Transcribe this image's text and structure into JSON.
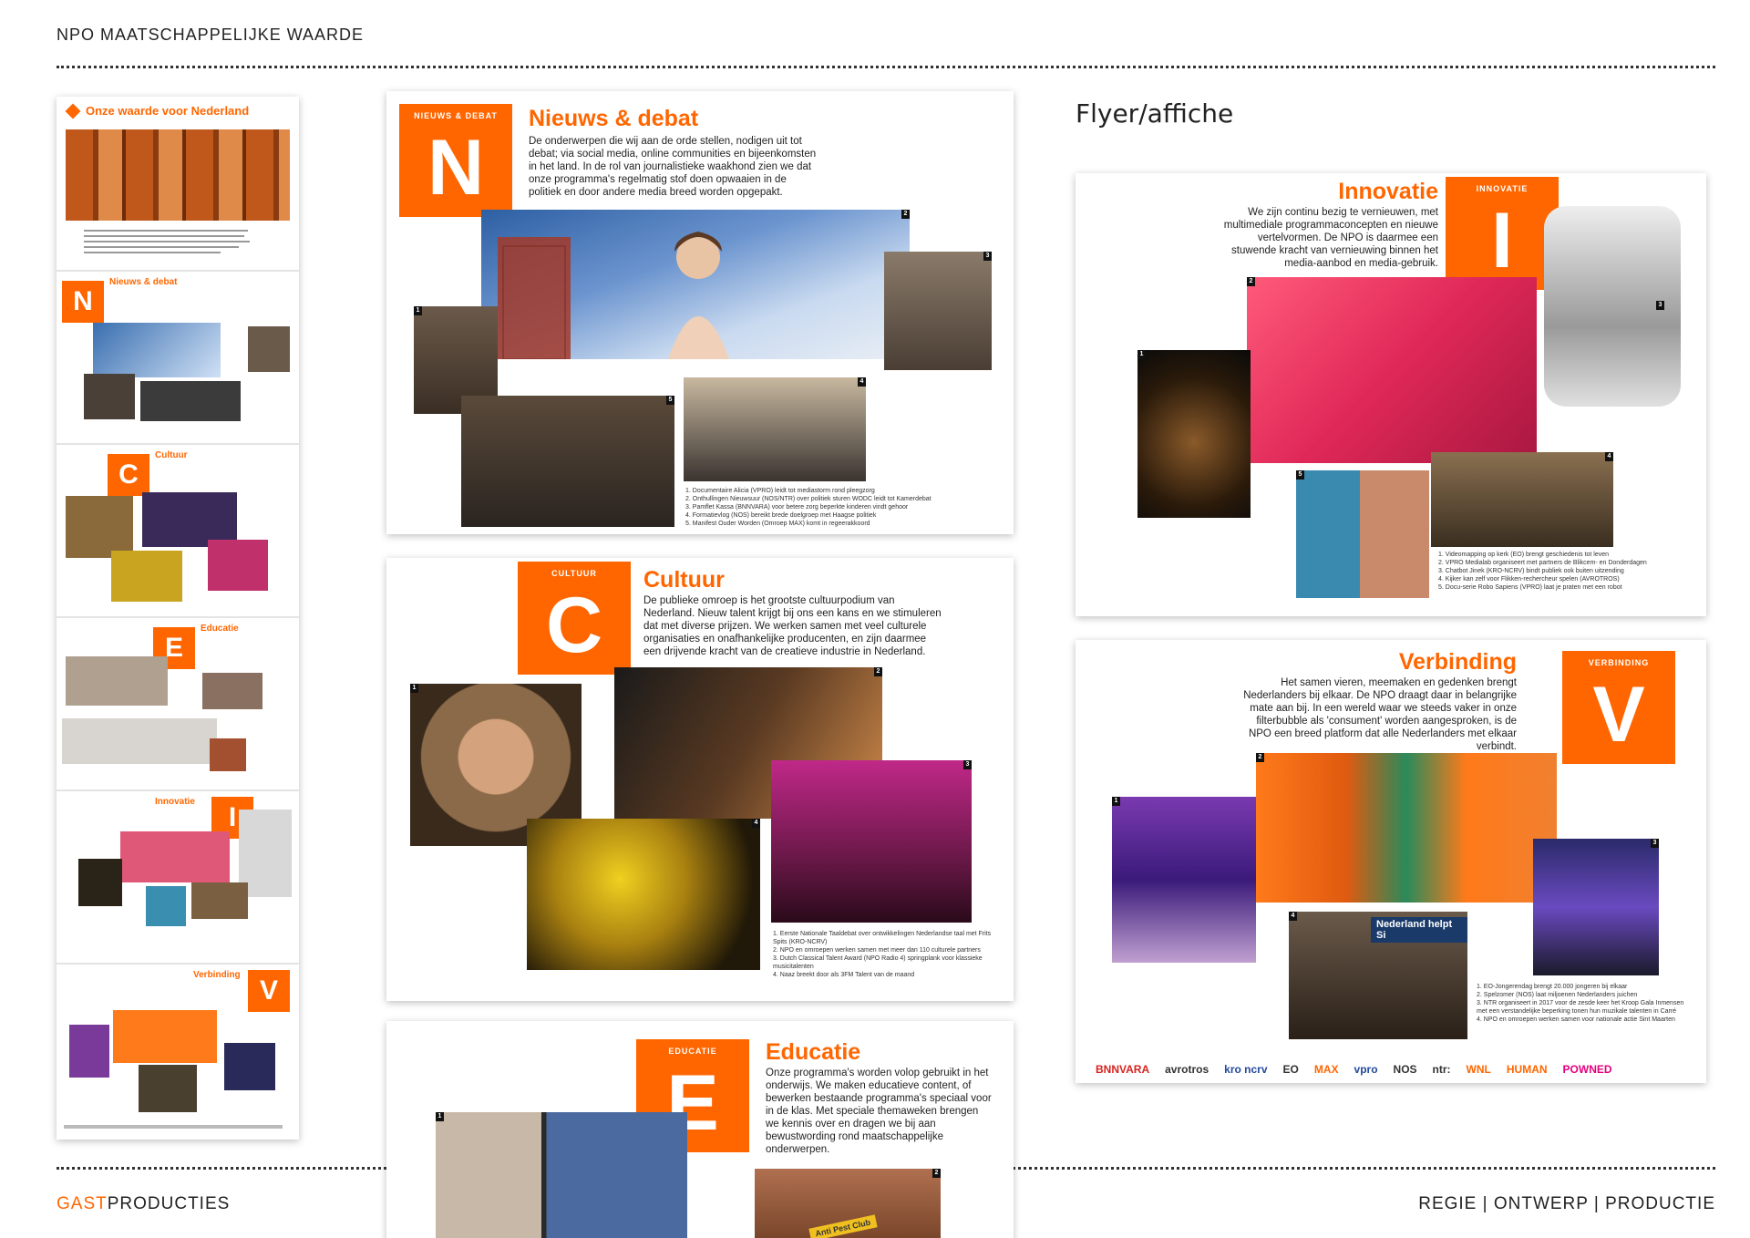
{
  "header": {
    "title": "NPO MAATSCHAPPELIJKE WAARDE"
  },
  "footer": {
    "brand_accent": "GAST",
    "brand_rest": "PRODUCTIES",
    "tagline": "REGIE | ONTWERP | PRODUCTIE"
  },
  "flyer_label": "Flyer/affiche",
  "thumbnail": {
    "title": "Onze waarde voor Nederland",
    "sections": [
      {
        "letter": "N",
        "label": "Nieuws & debat"
      },
      {
        "letter": "C",
        "label": "Cultuur"
      },
      {
        "letter": "E",
        "label": "Educatie"
      },
      {
        "letter": "I",
        "label": "Innovatie"
      },
      {
        "letter": "V",
        "label": "Verbinding"
      }
    ]
  },
  "nieuws": {
    "tag": "NIEUWS & DEBAT",
    "letter": "N",
    "title": "Nieuws & debat",
    "body": "De onderwerpen die wij aan de orde stellen, nodigen uit tot debat; via social media, online communities en bijeenkomsten in het land. In de rol van journalistieke waakhond zien we dat onze programma's regelmatig stof doen opwaaien in de politiek en door andere media breed worden opgepakt.",
    "captions": [
      "1. Documentaire Alicia (VPRO) leidt tot mediastorm rond pleegzorg",
      "2. Onthullingen Nieuwsuur (NOS/NTR) over politiek sturen WODC leidt tot Kamerdebat",
      "3. Pamflet Kassa (BNNVARA) voor betere zorg beperkte kinderen vindt gehoor",
      "4. Formatievlog (NOS) bereikt brede doelgroep met Haagse politiek",
      "5. Manifest Ouder Worden (Omroep MAX) komt in regeerakkoord"
    ]
  },
  "cultuur": {
    "tag": "CULTUUR",
    "letter": "C",
    "title": "Cultuur",
    "body": "De publieke omroep is het grootste cultuurpodium van Nederland. Nieuw talent krijgt bij ons een kans en we stimuleren dat met diverse prijzen. We werken samen met veel culturele organisaties en onafhankelijke producenten, en zijn daarmee een drijvende kracht van de creatieve industrie in Nederland.",
    "captions": [
      "1. Eerste Nationale Taaldebat over ontwikkelingen Nederlandse taal met Frits Spits (KRO-NCRV)",
      "2. NPO en omroepen werken samen met meer dan 110 culturele partners",
      "3. Dutch Classical Talent Award (NPO Radio 4) springplank voor klassieke musicitalenten",
      "4. Naaz breekt door als 3FM Talent van de maand"
    ]
  },
  "educatie": {
    "tag": "EDUCATIE",
    "letter": "E",
    "title": "Educatie",
    "body": "Onze programma's worden volop gebruikt in het onderwijs. We maken educatieve content, of bewerken bestaande programma's speciaal voor in de klas. Met speciale themaweken brengen we kennis over en dragen we bij aan bewustwording rond maatschappelijke onderwerpen.",
    "sticker": "Anti Pest Club"
  },
  "innovatie": {
    "tag": "INNOVATIE",
    "letter": "I",
    "title": "Innovatie",
    "body": "We zijn continu bezig te vernieuwen, met multimediale programmaconcepten en nieuwe vertelvormen. De NPO is daarmee een stuwende kracht van vernieuwing binnen het media-aanbod en media-gebruik.",
    "captions": [
      "1. Videomapping op kerk (EO) brengt geschiedenis tot leven",
      "2. VPRO Medialab organiseert met partners de Blikcem- en Donderdagen",
      "3. Chatbot Jinek (KRO-NCRV) bindt publiek ook buiten uitzending",
      "4. Kijker kan zelf voor Flikken-rechercheur spelen (AVROTROS)",
      "5. Docu-serie Robo Sapiens (VPRO) laat je praten met een robot"
    ]
  },
  "verbinding": {
    "tag": "VERBINDING",
    "letter": "V",
    "title": "Verbinding",
    "body": "Het samen vieren, meemaken en gedenken brengt Nederlanders bij elkaar. De NPO draagt daar in belangrijke mate aan bij. In een wereld waar we steeds vaker in onze filterbubble als 'consument' worden aangesproken, is de NPO een breed platform dat alle Nederlanders met elkaar verbindt.",
    "sign": "Nederland helpt Si",
    "captions": [
      "1. EO-Jongerendag brengt 20.000 jongeren bij elkaar",
      "2. Spelzomer (NOS) laat miljoenen Nederlanders juichen",
      "3. NTR organiseert in 2017 voor de zesde keer het Kroop Gala Inmensen met een verstandelijke beperking tonen hun muzikale talenten in Carré",
      "4. NPO en omroepen werken samen voor nationale actie Sint Maarten"
    ],
    "logos": [
      "BNNVARA",
      "avrotros",
      "kro ncrv",
      "EO",
      "MAX",
      "vpro",
      "NOS",
      "ntr:",
      "WNL",
      "HUMAN",
      "POWNED"
    ]
  },
  "colors": {
    "accent": "#ff6600",
    "text": "#222222"
  },
  "icons": [
    "orange-diamond-icon"
  ]
}
